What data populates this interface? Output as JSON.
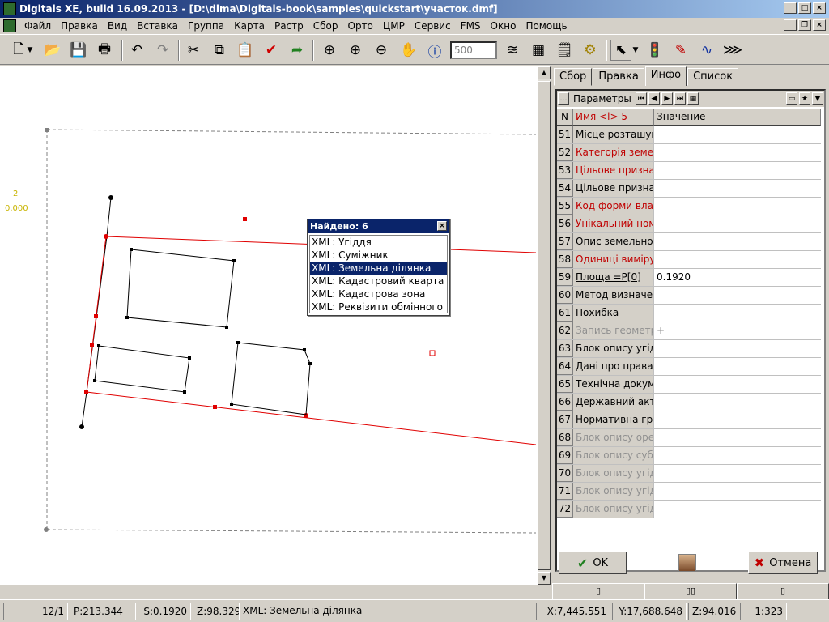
{
  "titlebar": {
    "title": "Digitals XE, build 16.09.2013 - [D:\\dima\\Digitals-book\\samples\\quickstart\\участок.dmf]"
  },
  "menu": [
    "Файл",
    "Правка",
    "Вид",
    "Вставка",
    "Группа",
    "Карта",
    "Растр",
    "Сбор",
    "Орто",
    "ЦМР",
    "Сервис",
    "FMS",
    "Окно",
    "Помощь"
  ],
  "toolbar": {
    "zoom_value": "500"
  },
  "canvas": {
    "label_top": "2",
    "label_bottom": "0.000"
  },
  "popup": {
    "title": "Найдено: 6",
    "items": [
      "XML: Угіддя",
      "XML: Суміжник",
      "XML: Земельна ділянка",
      "XML: Кадастровий кварта",
      "XML: Кадастрова зона",
      "XML: Реквізити обмінного"
    ],
    "selected_index": 2
  },
  "panel": {
    "tabs": [
      "Сбор",
      "Правка",
      "Инфо",
      "Список"
    ],
    "active_tab": "Инфо",
    "params_label": "Параметры",
    "col_n": "N",
    "col_name": "Имя <l> 5",
    "col_value": "Значение",
    "rows": [
      {
        "n": "51",
        "name": "Місце розташування",
        "value": "",
        "color": "#000000"
      },
      {
        "n": "52",
        "name": "Категорія земель",
        "value": "",
        "color": "#c00000"
      },
      {
        "n": "53",
        "name": "Цільове призначення",
        "value": "",
        "color": "#c00000"
      },
      {
        "n": "54",
        "name": "Цільове призначення",
        "value": "",
        "color": "#000000"
      },
      {
        "n": "55",
        "name": "Код форми власності",
        "value": "",
        "color": "#c00000"
      },
      {
        "n": "56",
        "name": "Унікальний номер",
        "value": "",
        "color": "#c00000"
      },
      {
        "n": "57",
        "name": "Опис земельної",
        "value": "",
        "color": "#000000"
      },
      {
        "n": "58",
        "name": "Одиниці виміру",
        "value": "",
        "color": "#c00000"
      },
      {
        "n": "59",
        "name": "Площа =P[0]",
        "value": "0.1920",
        "color": "#000000"
      },
      {
        "n": "60",
        "name": "Метод визначення",
        "value": "",
        "color": "#000000"
      },
      {
        "n": "61",
        "name": "Похибка",
        "value": "",
        "color": "#000000"
      },
      {
        "n": "62",
        "name": "Запись геометрії",
        "value": "+",
        "color": "#909090"
      },
      {
        "n": "63",
        "name": "Блок опису угідь",
        "value": "",
        "color": "#000000"
      },
      {
        "n": "64",
        "name": "Дані про права",
        "value": "",
        "color": "#000000"
      },
      {
        "n": "65",
        "name": "Технічна документація",
        "value": "",
        "color": "#000000"
      },
      {
        "n": "66",
        "name": "Державний акт",
        "value": "",
        "color": "#000000"
      },
      {
        "n": "67",
        "name": "Нормативна грошова",
        "value": "",
        "color": "#000000"
      },
      {
        "n": "68",
        "name": "Блок опису оренди",
        "value": "",
        "color": "#909090"
      },
      {
        "n": "69",
        "name": "Блок опису суборенди",
        "value": "",
        "color": "#909090"
      },
      {
        "n": "70",
        "name": "Блок опису угідь",
        "value": "",
        "color": "#909090"
      },
      {
        "n": "71",
        "name": "Блок опису угідь",
        "value": "",
        "color": "#909090"
      },
      {
        "n": "72",
        "name": "Блок опису угідь",
        "value": "",
        "color": "#909090"
      }
    ],
    "ok_label": "OK",
    "cancel_label": "Отмена"
  },
  "status": {
    "page": "12/1",
    "perimeter": "P:213.344",
    "area": "S:0.1920",
    "z1": "Z:98.329",
    "object": "XML: Земельна ділянка",
    "x": "X:7,445.551",
    "y": "Y:17,688.648",
    "z2": "Z:94.016",
    "scale": "1:323"
  }
}
